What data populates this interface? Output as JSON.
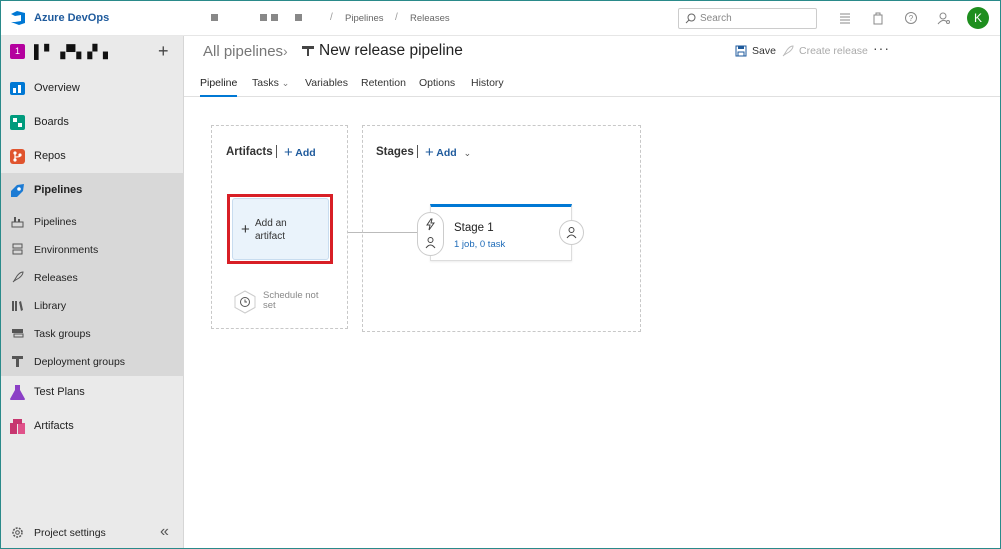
{
  "brand": {
    "name": "Azure DevOps"
  },
  "project": {
    "badge": "1",
    "name": "▌▘▗▀▖▞ ▖"
  },
  "sidebar": {
    "items": [
      {
        "label": "Overview"
      },
      {
        "label": "Boards"
      },
      {
        "label": "Repos"
      },
      {
        "label": "Pipelines"
      },
      {
        "label": "Test Plans"
      },
      {
        "label": "Artifacts"
      }
    ],
    "pipelines_sub": [
      {
        "label": "Pipelines"
      },
      {
        "label": "Environments"
      },
      {
        "label": "Releases"
      },
      {
        "label": "Library"
      },
      {
        "label": "Task groups"
      },
      {
        "label": "Deployment groups"
      }
    ],
    "project_settings": "Project settings"
  },
  "topbar": {
    "breadcrumbs": [
      "Pipelines",
      "Releases"
    ],
    "search_placeholder": "Search",
    "avatar_initial": "K"
  },
  "header": {
    "all_pipelines": "All pipelines",
    "title": "New release pipeline",
    "save": "Save",
    "create_release": "Create release",
    "more": "···"
  },
  "tabs": [
    {
      "label": "Pipeline",
      "active": true
    },
    {
      "label": "Tasks",
      "dropdown": true
    },
    {
      "label": "Variables"
    },
    {
      "label": "Retention"
    },
    {
      "label": "Options"
    },
    {
      "label": "History"
    }
  ],
  "canvas": {
    "artifacts_title": "Artifacts",
    "stages_title": "Stages",
    "add_label": "Add",
    "add_artifact": "Add an artifact",
    "schedule": "Schedule not set",
    "stage": {
      "name": "Stage 1",
      "tasks": "1 job, 0 task"
    }
  },
  "colors": {
    "accent": "#0078d4",
    "highlight": "#d81f26",
    "avatar": "#1e8e1e"
  }
}
